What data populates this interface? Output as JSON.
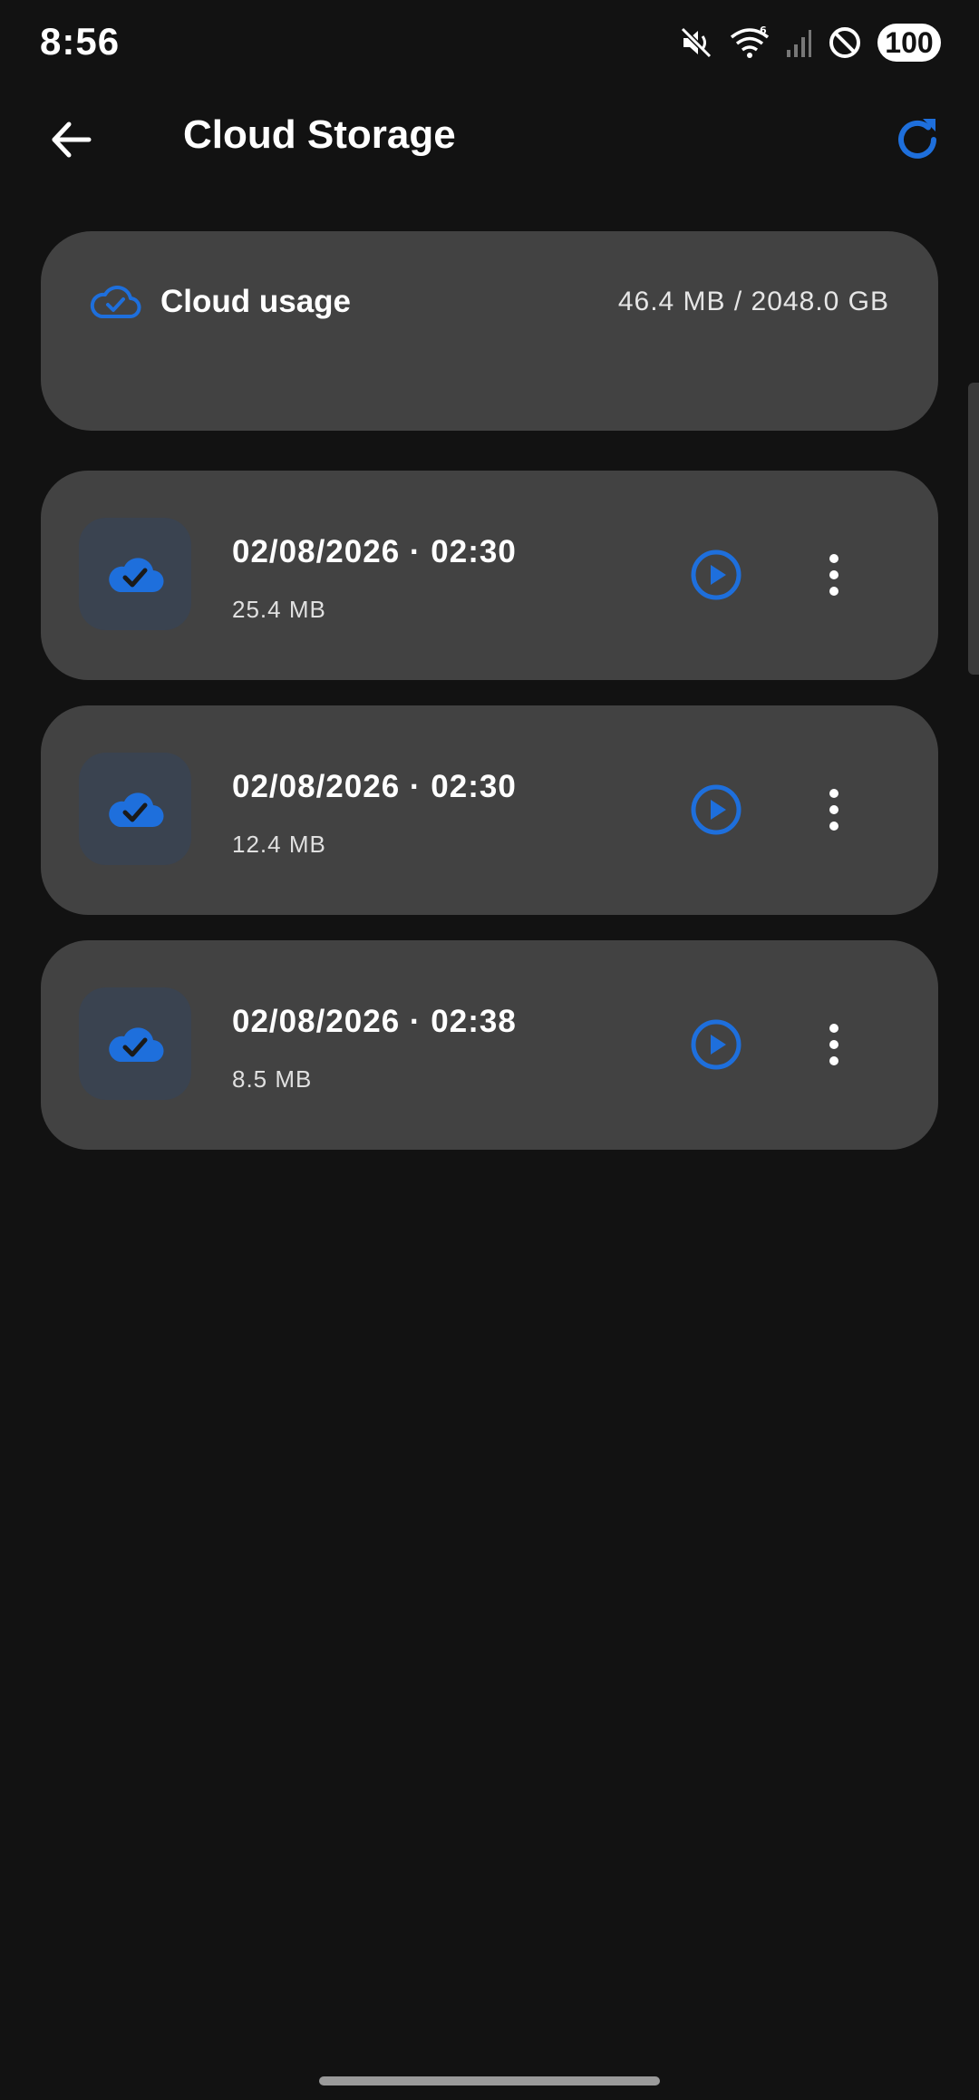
{
  "status_bar": {
    "time": "8:56",
    "battery": "100",
    "icons": [
      "mute-icon",
      "wifi-icon",
      "signal-icon",
      "do-not-disturb-icon"
    ]
  },
  "app_bar": {
    "title": "Cloud Storage",
    "back_icon": "arrow-left-icon",
    "refresh_icon": "refresh-icon"
  },
  "usage": {
    "label": "Cloud usage",
    "value": "46.4 MB / 2048.0 GB",
    "icon": "cloud-check-outline-icon"
  },
  "recordings": [
    {
      "title": "02/08/2026 · 02:30",
      "size": "25.4 MB"
    },
    {
      "title": "02/08/2026 · 02:30",
      "size": "12.4 MB"
    },
    {
      "title": "02/08/2026 · 02:38",
      "size": "8.5 MB"
    }
  ],
  "colors": {
    "background": "#121212",
    "card": "#424242",
    "accent": "#1e6fdc",
    "thumb_bg": "#3a4350",
    "text": "#ffffff"
  }
}
